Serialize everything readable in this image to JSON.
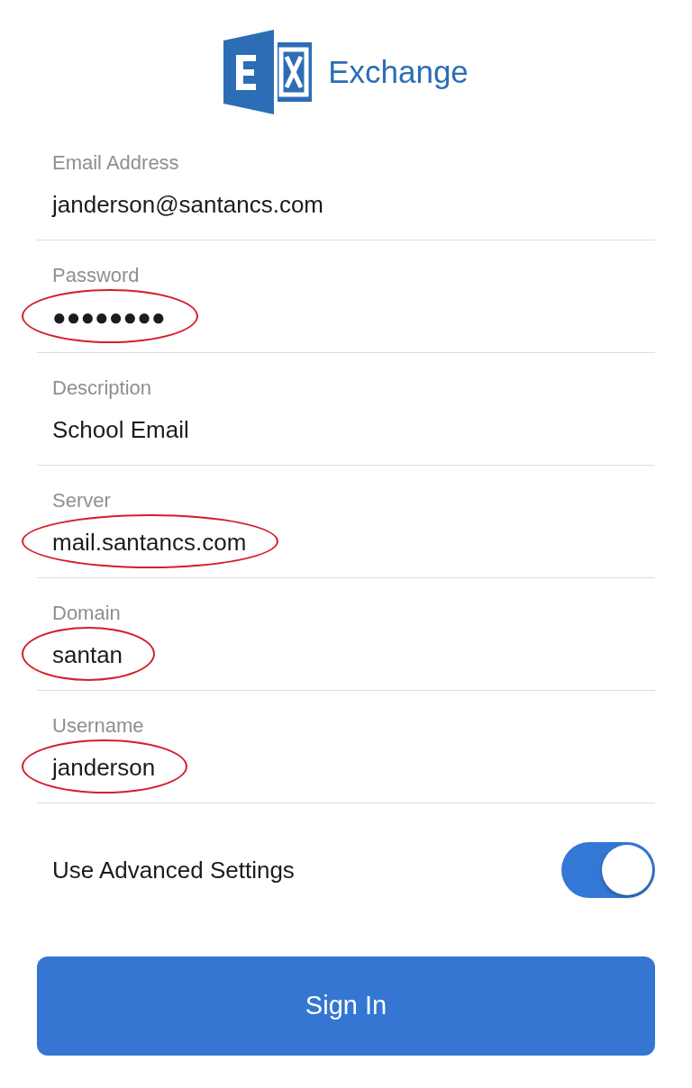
{
  "logo": {
    "text": "Exchange"
  },
  "fields": [
    {
      "label": "Email Address",
      "value": "janderson@santancs.com",
      "circled": false
    },
    {
      "label": "Password",
      "value": "●●●●●●●●",
      "circled": true
    },
    {
      "label": "Description",
      "value": "School Email",
      "circled": false
    },
    {
      "label": "Server",
      "value": "mail.santancs.com",
      "circled": true
    },
    {
      "label": "Domain",
      "value": "santan",
      "circled": true
    },
    {
      "label": "Username",
      "value": "janderson",
      "circled": true
    }
  ],
  "advanced": {
    "label": "Use Advanced Settings",
    "on": true
  },
  "sign_in": {
    "label": "Sign In"
  }
}
